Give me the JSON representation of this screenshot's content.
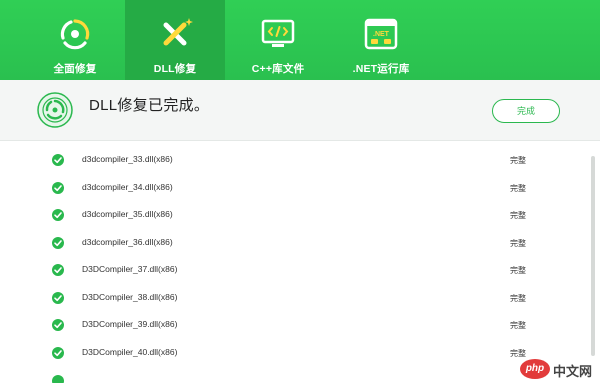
{
  "tabs": [
    {
      "label": "全面修复",
      "icon": "refresh-icon",
      "active": false
    },
    {
      "label": "DLL修复",
      "icon": "wrench-sparkle-icon",
      "active": true
    },
    {
      "label": "C++库文件",
      "icon": "code-monitor-icon",
      "active": false
    },
    {
      "label": ".NET运行库",
      "icon": "dotnet-window-icon",
      "active": false
    }
  ],
  "net_badge": ".NET",
  "status": {
    "message": "DLL修复已完成。",
    "button_label": "完成"
  },
  "files": [
    {
      "name": "d3dcompiler_33.dll(x86)",
      "status": "完整"
    },
    {
      "name": "d3dcompiler_34.dll(x86)",
      "status": "完整"
    },
    {
      "name": "d3dcompiler_35.dll(x86)",
      "status": "完整"
    },
    {
      "name": "d3dcompiler_36.dll(x86)",
      "status": "完整"
    },
    {
      "name": "D3DCompiler_37.dll(x86)",
      "status": "完整"
    },
    {
      "name": "D3DCompiler_38.dll(x86)",
      "status": "完整"
    },
    {
      "name": "D3DCompiler_39.dll(x86)",
      "status": "完整"
    },
    {
      "name": "D3DCompiler_40.dll(x86)",
      "status": "完整"
    }
  ],
  "watermark": {
    "php": "php",
    "site": "中文网"
  },
  "colors": {
    "header": "#2ac04f",
    "active_tab": "#25ab45",
    "check": "#29b84d",
    "accent": "#2bb84f"
  }
}
